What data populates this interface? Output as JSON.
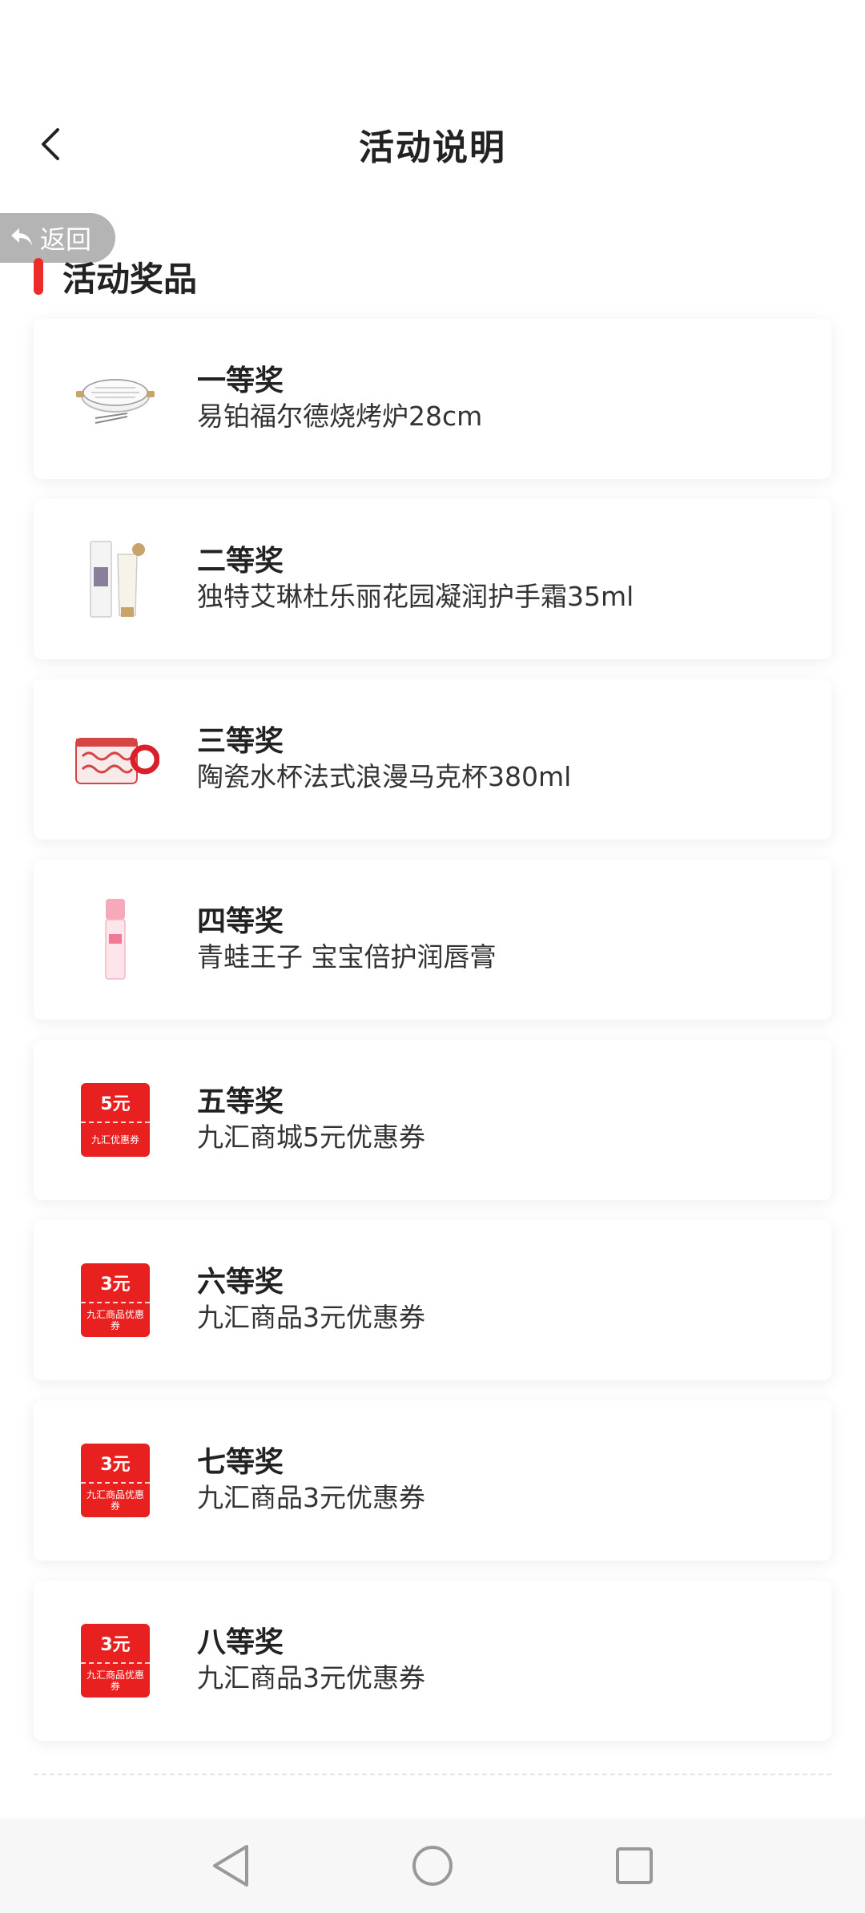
{
  "header": {
    "title": "活动说明",
    "back_icon": "chevron-left-icon"
  },
  "return_pill": {
    "label": "返回",
    "icon": "return-arrow-icon"
  },
  "section": {
    "title": "活动奖品",
    "accent": "#ee2b2b"
  },
  "prizes": [
    {
      "level": "一等奖",
      "name": "易铂福尔德烧烤炉28cm",
      "icon": "grill-icon"
    },
    {
      "level": "二等奖",
      "name": "独特艾琳杜乐丽花园凝润护手霜35ml",
      "icon": "hand-cream-icon"
    },
    {
      "level": "三等奖",
      "name": "陶瓷水杯法式浪漫马克杯380ml",
      "icon": "mug-icon"
    },
    {
      "level": "四等奖",
      "name": "青蛙王子 宝宝倍护润唇膏",
      "icon": "lip-balm-icon"
    },
    {
      "level": "五等奖",
      "name": "九汇商城5元优惠券",
      "icon": "coupon-icon",
      "coupon_amount": "5元",
      "coupon_sub": "九汇优惠券"
    },
    {
      "level": "六等奖",
      "name": "九汇商品3元优惠券",
      "icon": "coupon-icon",
      "coupon_amount": "3元",
      "coupon_sub": "九汇商品优惠券"
    },
    {
      "level": "七等奖",
      "name": "九汇商品3元优惠券",
      "icon": "coupon-icon",
      "coupon_amount": "3元",
      "coupon_sub": "九汇商品优惠券"
    },
    {
      "level": "八等奖",
      "name": "九汇商品3元优惠券",
      "icon": "coupon-icon",
      "coupon_amount": "3元",
      "coupon_sub": "九汇商品优惠券"
    }
  ],
  "system_nav": {
    "back": "triangle-back-icon",
    "home": "circle-home-icon",
    "recents": "square-recents-icon"
  }
}
